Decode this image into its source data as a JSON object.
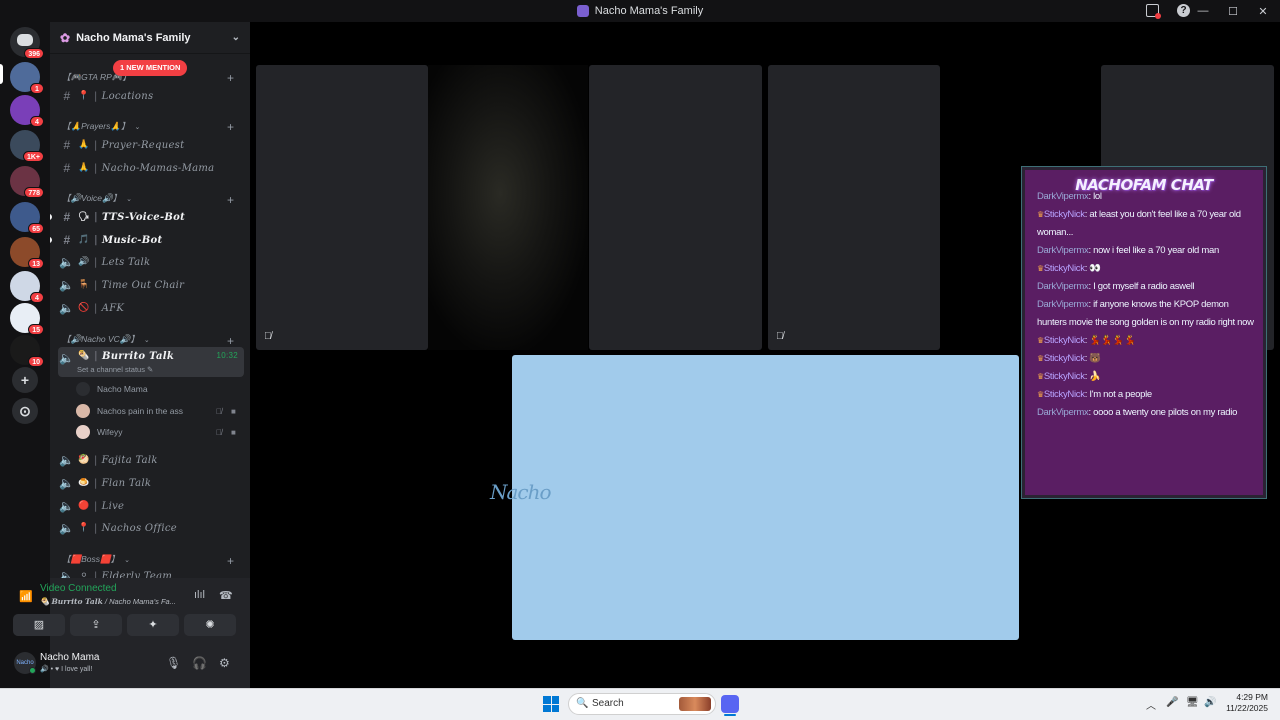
{
  "window": {
    "title": "Nacho Mama's Family",
    "controls": [
      "—",
      "☐",
      "✕"
    ]
  },
  "rail": {
    "home_badge": "396",
    "servers": [
      {
        "name": "server-1",
        "badge": "1",
        "color": "#4f6b9a"
      },
      {
        "name": "server-2",
        "badge": "4",
        "color": "#7a3fb8"
      },
      {
        "name": "server-3",
        "badge": "1K+",
        "color": "#3b4a5c"
      },
      {
        "name": "server-4",
        "badge": "778",
        "color": "#6b3344"
      },
      {
        "name": "server-5",
        "badge": "65",
        "color": "#3e5a8c"
      },
      {
        "name": "server-6",
        "badge": "13",
        "color": "#8c4a2a"
      },
      {
        "name": "server-7",
        "badge": "4",
        "color": "#cfd8e6"
      },
      {
        "name": "server-8",
        "badge": "15",
        "color": "#e8eef5"
      },
      {
        "name": "server-9",
        "badge": "10",
        "color": "#1a1a1a"
      }
    ],
    "add_label": "+",
    "discover_label": "⊙"
  },
  "sidebar": {
    "server_name": "Nacho Mama's Family",
    "mention_pill": "1 NEW MENTION",
    "categories": {
      "gta": "【🎮GTA RP🎮】",
      "prayers": "【🙏Prayers🙏】",
      "voice": "【🔊Voice🔊】",
      "nacho_vc": "【🔊Nacho VC🔊】",
      "boss": "【🟥Boss🟥】"
    },
    "channels": {
      "locations": {
        "emoji": "📍",
        "name": "Locations"
      },
      "prayer_request": {
        "emoji": "🙏",
        "name": "Prayer-Request"
      },
      "nacho_mamas_mama": {
        "emoji": "🙏",
        "name": "Nacho-Mamas-Mama"
      },
      "tts_voice_bot": {
        "emoji": "🗣",
        "name": "TTS-Voice-Bot"
      },
      "music_bot": {
        "emoji": "🎵",
        "name": "Music-Bot"
      },
      "lets_talk": {
        "emoji": "🔊",
        "name": "Lets Talk"
      },
      "time_out_chair": {
        "emoji": "🪑",
        "name": "Time Out Chair"
      },
      "afk": {
        "emoji": "🚫",
        "name": "AFK"
      },
      "burrito_talk": {
        "emoji": "🌯",
        "name": "Burrito Talk",
        "time": "10:32"
      },
      "fajita_talk": {
        "emoji": "🥙",
        "name": "Fajita Talk"
      },
      "flan_talk": {
        "emoji": "🍮",
        "name": "Flan Talk"
      },
      "live": {
        "emoji": "🔴",
        "name": "Live"
      },
      "nachos_office": {
        "emoji": "📍",
        "name": "Nachos Office"
      },
      "elderly_team": {
        "emoji": "⚪",
        "name": "Elderly Team"
      }
    },
    "channel_status": "Set a channel status ✎",
    "voice_users": [
      {
        "name": "Nacho Mama",
        "color": "#2b2d31"
      },
      {
        "name": "Nachos pain in the ass",
        "color": "#d9b8a8"
      },
      {
        "name": "Wifeyy",
        "color": "#e8d0c8"
      }
    ]
  },
  "voice_panel": {
    "status": "Video Connected",
    "channel": "Burrito Talk",
    "server": "/ Nacho Mama's Fa...",
    "buttons": [
      "▨",
      "⇪",
      "✦",
      "✺"
    ]
  },
  "user": {
    "avatar_text": "Nacho",
    "name": "Nacho Mama",
    "status": "🔊 • ♥ I love yall!"
  },
  "chat_overlay": {
    "title": "NACHOFAM CHAT",
    "messages": [
      {
        "user": "DarkVipermx",
        "type": "plain",
        "text": "lol"
      },
      {
        "user": "StickyNick",
        "type": "crown",
        "text": "at least you don't feel like a 70 year old woman..."
      },
      {
        "user": "DarkVipermx",
        "type": "plain",
        "text": "now i feel like a 70 year old man"
      },
      {
        "user": "StickyNick",
        "type": "crown",
        "text": "👀"
      },
      {
        "user": "DarkVipermx",
        "type": "plain",
        "text": "I got myself a radio aswell"
      },
      {
        "user": "DarkVipermx",
        "type": "plain",
        "text": "if anyone knows the KPOP demon hunters movie the song golden is on my radio right now"
      },
      {
        "user": "StickyNick",
        "type": "crown",
        "text": "💃💃💃💃"
      },
      {
        "user": "StickyNick",
        "type": "crown",
        "text": "🐻"
      },
      {
        "user": "StickyNick",
        "type": "crown",
        "text": "🍌"
      },
      {
        "user": "StickyNick",
        "type": "crown",
        "text": "I'm not a people"
      },
      {
        "user": "DarkVipermx",
        "type": "plain",
        "text": "oooo a twenty one pilots on my radio"
      }
    ]
  },
  "stage": {
    "share_logo": "Nacho"
  },
  "taskbar": {
    "search_placeholder": "Search",
    "time": "4:29 PM",
    "date": "11/22/2025",
    "tray_icons": [
      "︿",
      "🎤",
      "🖥",
      "🔊"
    ]
  }
}
